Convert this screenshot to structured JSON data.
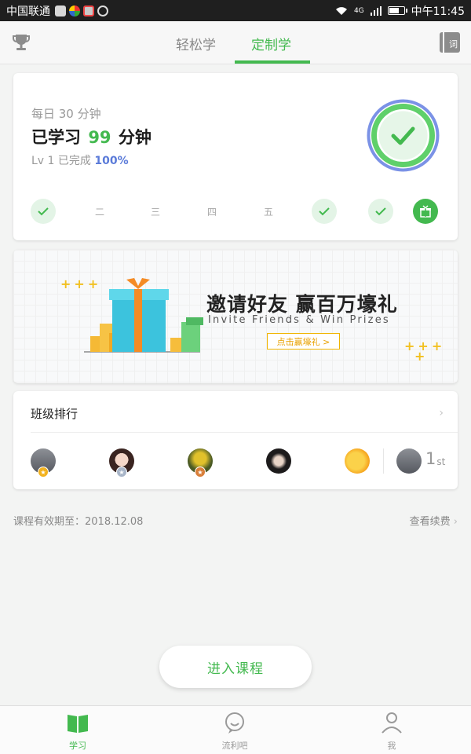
{
  "status_bar": {
    "carrier": "中国联通",
    "network": "4G",
    "time": "中午11:45"
  },
  "header": {
    "tabs": [
      {
        "label": "轻松学"
      },
      {
        "label": "定制学"
      }
    ],
    "vocab_icon_text": "词"
  },
  "progress_card": {
    "daily_goal": "每日 30 分钟",
    "studied_prefix": "已学习",
    "studied_minutes": "99",
    "studied_suffix": "分钟",
    "level_prefix": "Lv 1 已完成",
    "level_percent": "100%",
    "days": [
      {
        "label": "",
        "state": "done"
      },
      {
        "label": "二",
        "state": "empty"
      },
      {
        "label": "三",
        "state": "empty"
      },
      {
        "label": "四",
        "state": "empty"
      },
      {
        "label": "五",
        "state": "empty"
      },
      {
        "label": "",
        "state": "done"
      },
      {
        "label": "",
        "state": "done"
      },
      {
        "label": "",
        "state": "gift"
      }
    ]
  },
  "banner": {
    "title": "邀请好友 赢百万壕礼",
    "subtitle": "Invite Friends & Win Prizes",
    "button": "点击赢壕礼 >"
  },
  "ranking": {
    "title": "班级排行",
    "my_rank_number": "1",
    "my_rank_suffix": "st"
  },
  "course": {
    "validity": "课程有效期至：2018.12.08",
    "renew": "查看续费"
  },
  "enter_button": "进入课程",
  "tabbar": [
    {
      "label": "学习"
    },
    {
      "label": "流利吧"
    },
    {
      "label": "我"
    }
  ],
  "colors": {
    "accent_green": "#43b94f",
    "level_blue": "#5b7bd9",
    "gold": "#f0b400"
  }
}
